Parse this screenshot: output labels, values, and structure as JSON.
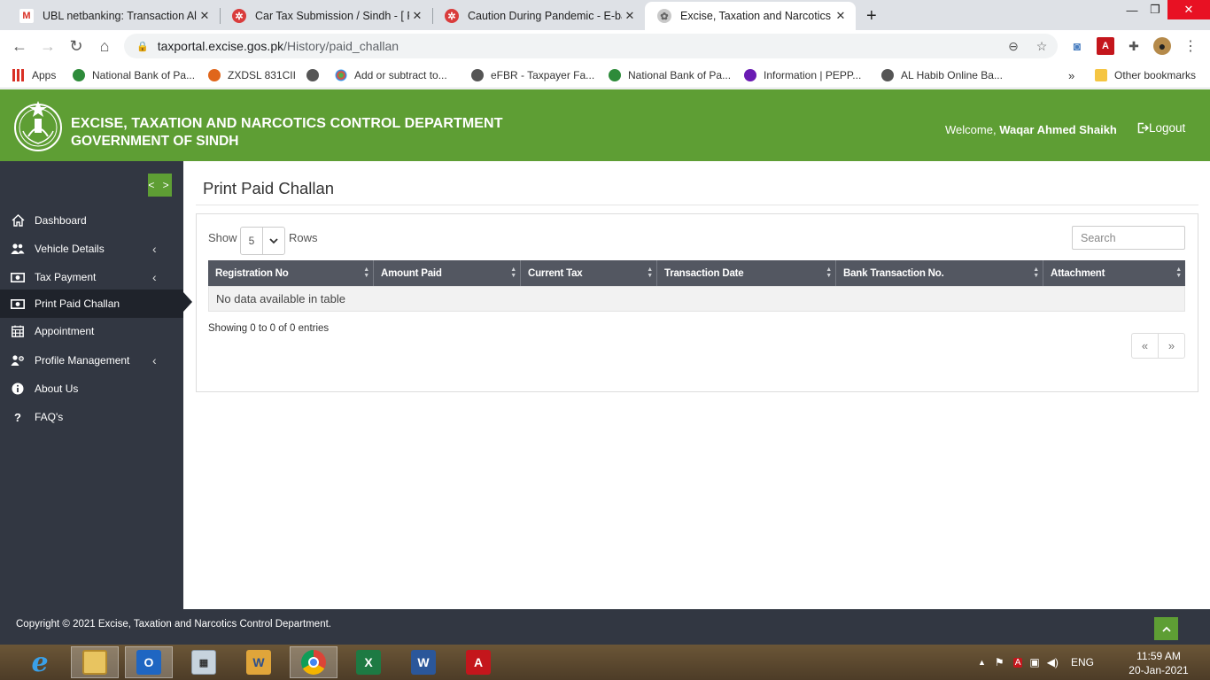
{
  "browser": {
    "tabs": [
      {
        "title": "UBL netbanking: Transaction Aler",
        "icon": "gmail-icon"
      },
      {
        "title": "Car Tax Submission / Sindh - [ Fi",
        "icon": "web-icon"
      },
      {
        "title": "Caution During Pandemic - E-bar",
        "icon": "web-icon"
      },
      {
        "title": "Excise, Taxation and Narcotics Co",
        "icon": "excise-icon",
        "active": true
      }
    ],
    "new_tab": "+",
    "url_host": "taxportal.excise.gos.pk",
    "url_path": "/History/paid_challan",
    "bookmarks": [
      {
        "label": "Apps"
      },
      {
        "label": "National Bank of Pa..."
      },
      {
        "label": "ZXDSL 831CII"
      },
      {
        "label": "Add or subtract to..."
      },
      {
        "label": "eFBR - Taxpayer Fa..."
      },
      {
        "label": "National Bank of Pa..."
      },
      {
        "label": "Information | PEPP..."
      },
      {
        "label": "AL Habib Online Ba..."
      }
    ],
    "bookmarks_more": "»",
    "other_bookmarks": "Other bookmarks"
  },
  "header": {
    "line1": "EXCISE, TAXATION AND NARCOTICS CONTROL DEPARTMENT",
    "line2": "GOVERNMENT OF SINDH",
    "welcome_prefix": "Welcome,",
    "user_name": "Waqar Ahmed Shaikh",
    "logout": "Logout"
  },
  "sidebar": {
    "toggle": "< >",
    "items": [
      {
        "label": "Dashboard",
        "icon": "home-icon"
      },
      {
        "label": "Vehicle Details",
        "icon": "users-icon",
        "arrow": "‹"
      },
      {
        "label": "Tax Payment",
        "icon": "money-icon",
        "arrow": "‹"
      },
      {
        "label": "Print Paid Challan",
        "icon": "money-icon",
        "active": true
      },
      {
        "label": "Appointment",
        "icon": "calendar-icon"
      },
      {
        "label": "Profile Management",
        "icon": "users-cog-icon",
        "arrow": "‹"
      },
      {
        "label": "About Us",
        "icon": "info-icon"
      },
      {
        "label": "FAQ's",
        "icon": "question-icon"
      }
    ]
  },
  "main": {
    "title": "Print Paid Challan",
    "show_label": "Show",
    "rows_value": "5",
    "rows_label": "Rows",
    "search_placeholder": "Search",
    "columns": [
      "Registration No",
      "Amount Paid",
      "Current Tax",
      "Transaction Date",
      "Bank Transaction No.",
      "Attachment"
    ],
    "empty_message": "No data available in table",
    "info": "Showing 0 to 0 of 0 entries",
    "pager_prev": "«",
    "pager_next": "»"
  },
  "footer": {
    "copyright": "Copyright © 2021 Excise, Taxation and Narcotics Control Department."
  },
  "taskbar": {
    "language": "ENG",
    "time": "11:59 AM",
    "date": "20-Jan-2021"
  },
  "colors": {
    "brand_green": "#5e9e34",
    "sidebar_dark": "#323742",
    "table_header": "#535761"
  }
}
